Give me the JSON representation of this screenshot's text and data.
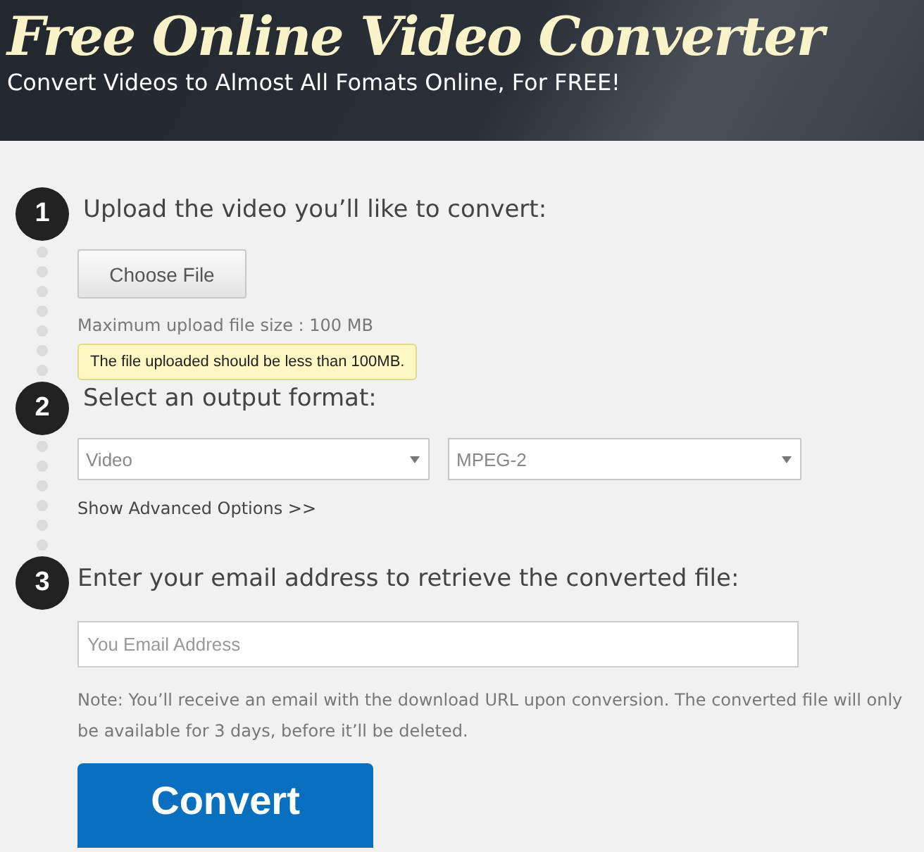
{
  "header": {
    "title": "Free Online Video Converter",
    "subtitle": "Convert Videos to Almost All Fomats Online, For FREE!"
  },
  "steps": [
    {
      "number": "1",
      "heading": "Upload the video you’ll like to convert:",
      "file_button": "Choose File",
      "hint": "Maximum upload file size : 100 MB",
      "tooltip": "The file uploaded should be less than 100MB."
    },
    {
      "number": "2",
      "heading": "Select an output format:",
      "selects": [
        {
          "value": "Video"
        },
        {
          "value": "MPEG-2"
        }
      ],
      "link": "Show Advanced Options >>"
    },
    {
      "number": "3",
      "heading": "Enter your email address to retrieve the converted file:",
      "email": {
        "placeholder": "You Email Address"
      },
      "note": "Note: You’ll receive an email with the download URL upon conversion. The converted file will only be available for 3 days, before it’ll be deleted.",
      "button": "Convert"
    }
  ]
}
